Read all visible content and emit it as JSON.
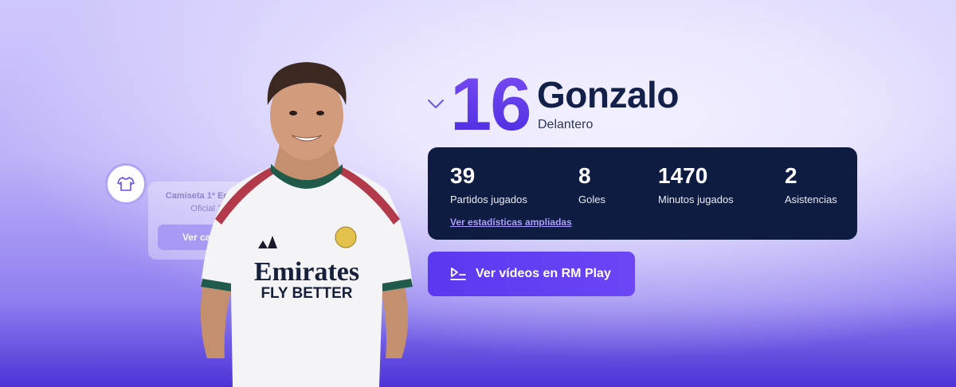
{
  "player": {
    "number": "16",
    "name": "Gonzalo",
    "position": "Delantero"
  },
  "jersey_card": {
    "name": "Camiseta 1ª Equipación",
    "subtitle": "Oficial 26/27",
    "button_label": "Ver camisetas"
  },
  "stats": [
    {
      "value": "39",
      "label": "Partidos jugados"
    },
    {
      "value": "8",
      "label": "Goles"
    },
    {
      "value": "1470",
      "label": "Minutos jugados"
    },
    {
      "value": "2",
      "label": "Asistencias"
    }
  ],
  "stats_link": "Ver estadísticas ampliadas",
  "cta_label": "Ver vídeos en RM Play",
  "shirt_sponsor": "Emirates",
  "shirt_slogan": "FLY BETTER",
  "icons": {
    "chevron": "chevron-down-icon",
    "jersey": "shirt-icon",
    "play": "play-list-icon"
  },
  "colors": {
    "accent": "#5b38f0",
    "number_gradient_top": "#7a4cf5",
    "dark_card": "#0f1c42",
    "name_text": "#12204a",
    "link": "#a99cff"
  }
}
